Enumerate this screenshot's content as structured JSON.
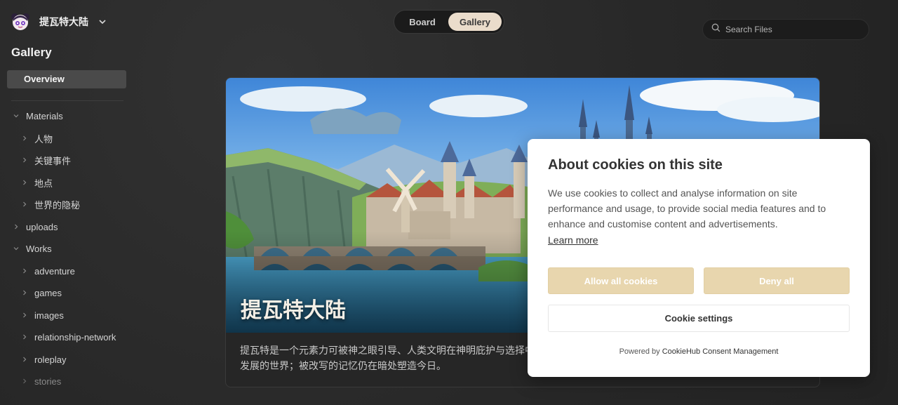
{
  "sidebar": {
    "brand_name": "提瓦特大陆",
    "section_title": "Gallery",
    "overview_label": "Overview",
    "tree": [
      {
        "label": "Materials"
      },
      {
        "label": "人物"
      },
      {
        "label": "关键事件"
      },
      {
        "label": "地点"
      },
      {
        "label": "世界的隐秘"
      },
      {
        "label": "uploads"
      },
      {
        "label": "Works"
      },
      {
        "label": "adventure"
      },
      {
        "label": "games"
      },
      {
        "label": "images"
      },
      {
        "label": "relationship-network"
      },
      {
        "label": "roleplay"
      },
      {
        "label": "stories"
      }
    ]
  },
  "topbar": {
    "tabs": [
      {
        "label": "Board",
        "active": false
      },
      {
        "label": "Gallery",
        "active": true
      }
    ],
    "search_placeholder": "Search Files"
  },
  "card": {
    "title": "提瓦特大陆",
    "description": "提瓦特是一个元素力可被神之眼引导、人类文明在神明庇护与选择中发展的世界；被改写的记忆仍在暗处塑造今日。"
  },
  "cookie_dialog": {
    "title": "About cookies on this site",
    "body": "We use cookies to collect and analyse information on site performance and usage, to provide social media features and to enhance and customise content and advertisements.",
    "learn_more": "Learn more",
    "allow_all": "Allow all cookies",
    "deny_all": "Deny all",
    "settings": "Cookie settings",
    "powered_prefix": "Powered by",
    "powered_link": "CookieHub Consent Management"
  },
  "colors": {
    "accent": "#eadccb",
    "cookie_button": "#e8d6ae",
    "background": "#2a2a2a"
  }
}
